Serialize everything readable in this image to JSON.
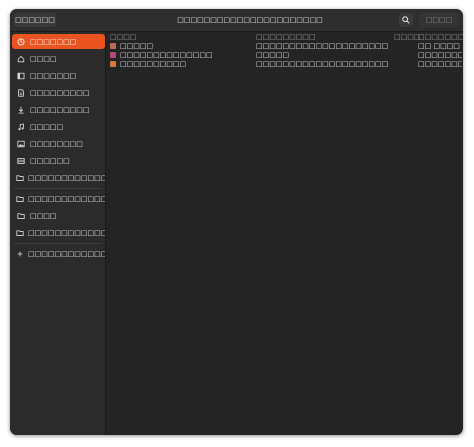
{
  "header": {
    "cancel_label": "□□□□□□",
    "title": "□□□□□□□□□□□□□□□□□□□□□□",
    "open_label": "□□□□"
  },
  "sidebar": {
    "items": [
      {
        "label": "□□□□□□□",
        "icon": "clock-icon",
        "active": true
      },
      {
        "label": "□□□□",
        "icon": "home-icon"
      },
      {
        "label": "□□□□□□□",
        "icon": "desktop-icon"
      },
      {
        "label": "□□□□□□□□□",
        "icon": "document-icon"
      },
      {
        "label": "□□□□□□□□□",
        "icon": "download-icon"
      },
      {
        "label": "□□□□□",
        "icon": "music-icon"
      },
      {
        "label": "□□□□□□□□",
        "icon": "image-icon"
      },
      {
        "label": "□□□□□□",
        "icon": "video-icon"
      },
      {
        "label": "□□□□□□□□□□□□□",
        "icon": "folder-icon"
      },
      {
        "label": "□□□□□□□□□□□□□□□□",
        "icon": "folder-icon"
      },
      {
        "label": "□□□□",
        "icon": "folder-icon"
      },
      {
        "label": "□□□□□□□□□□□□□□□□",
        "icon": "folder-icon"
      },
      {
        "label": "□□□□□□□□□□□□□□□□",
        "icon": "plus-icon"
      }
    ]
  },
  "table": {
    "columns": [
      "□□□□",
      "□□□□□□□□□",
      "□□□□",
      "□□□□□□□□"
    ],
    "rows": [
      {
        "name": "□□□□□",
        "location": "□□□□□□□□□□□□□□□□□□□□",
        "size": "",
        "modified": "□□ □□□□",
        "icon_color": "#c06a5a"
      },
      {
        "name": "□□□□□□□□□□□□□□",
        "location": "□□□□□",
        "size": "",
        "modified": "□□□□□□□□□□",
        "icon_color": "#b04c78"
      },
      {
        "name": "□□□□□□□□□□",
        "location": "□□□□□□□□□□□□□□□□□□□□",
        "size": "",
        "modified": "□□□□□□□□□□",
        "icon_color": "#d77b3a"
      }
    ]
  }
}
